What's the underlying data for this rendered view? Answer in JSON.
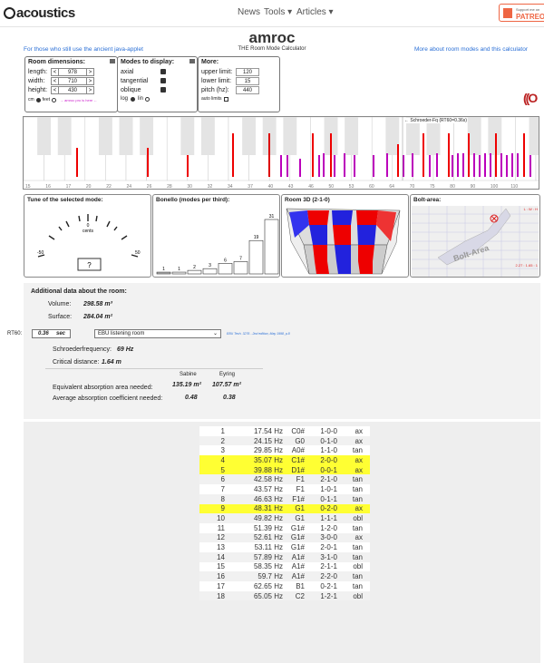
{
  "header": {
    "logo": "acoustics",
    "nav": [
      "News",
      "Tools ▾",
      "Articles ▾"
    ],
    "patreon_small": "Support me on",
    "patreon": "PATREON"
  },
  "page": {
    "title": "amroc",
    "subtitle": "THE Room Mode Calculator",
    "left_link": "For those who still use the ancient java-applet",
    "right_link": "More about room modes and this calculator"
  },
  "dims": {
    "title": "Room dimensions:",
    "length_label": "length:",
    "width_label": "width:",
    "height_label": "height:",
    "length": "978",
    "width": "710",
    "height": "430",
    "unit_cm": "cm",
    "unit_feet": "feet",
    "amroc_link": "→ amroc pro is here ←",
    "dec": "<",
    "inc": ">"
  },
  "modes": {
    "title": "Modes to display:",
    "axial": "axial",
    "tangential": "tangential",
    "oblique": "oblique",
    "log": "log",
    "lin": "lin"
  },
  "more": {
    "title": "More:",
    "upper_label": "upper limit:",
    "lower_label": "lower limit:",
    "pitch_label": "pitch (hz):",
    "upper": "120",
    "lower": "15",
    "pitch": "440",
    "auto": "auto limits"
  },
  "play_symbol": "((O",
  "schroeder_note": "← Schroeder-Fq (RT60=0.36s)",
  "keyboard_ticks": [
    "15",
    "16",
    "17",
    "20",
    "22",
    "24",
    "26",
    "28",
    "30",
    "32",
    "34",
    "37",
    "40",
    "43",
    "46",
    "50",
    "53",
    "60",
    "64",
    "70",
    "75",
    "80",
    "90",
    "100",
    "110"
  ],
  "tune": {
    "title": "Tune of the selected mode:",
    "zero": "0",
    "cents": "cents",
    "minus": "-50",
    "plus": "50",
    "value": "?"
  },
  "bonello": {
    "title": "Bonello (modes per third):",
    "bars": [
      1,
      1,
      2,
      3,
      6,
      7,
      19,
      31
    ],
    "bar_colors": [
      "#bbb",
      "#fff",
      "#fff",
      "#fff",
      "#fff",
      "#fff",
      "#fff",
      "#fff"
    ]
  },
  "room3d": {
    "title": "Room 3D (2-1-0)"
  },
  "bolt": {
    "title": "Bolt-area:",
    "axis": "L : W : H",
    "ratio": "2.27 : 1.65 : 1",
    "watermark": "Bolt-Area"
  },
  "additional": {
    "title": "Additional data about the room:",
    "volume_label": "Volume:",
    "volume": "298.58 m³",
    "surface_label": "Surface:",
    "surface": "284.04 m²",
    "rt60_label": "RT60:",
    "rt60": "0.36",
    "sec": "sec",
    "room_type": "EBU listening room",
    "ebu_ref": "EBU Tech. 3276 - 2nd edition, May 1998, p.8",
    "schroeder_label": "Schroederfrequency:",
    "schroeder": "69 Hz",
    "critical_label": "Critical distance:",
    "critical": "1.64 m",
    "sabine": "Sabine",
    "eyring": "Eyring",
    "eq_label": "Equivalent absorption area needed:",
    "eq_sabine": "135.19 m²",
    "eq_eyring": "107.57 m²",
    "avg_label": "Average absorption coefficient needed:",
    "avg_sabine": "0.48",
    "avg_eyring": "0.38"
  },
  "modes_table": [
    [
      "1",
      "17.54 Hz",
      "C0#",
      "1-0-0",
      "ax"
    ],
    [
      "2",
      "24.15 Hz",
      "G0",
      "0-1-0",
      "ax"
    ],
    [
      "3",
      "29.85 Hz",
      "A0#",
      "1-1-0",
      "tan"
    ],
    [
      "4",
      "35.07 Hz",
      "C1#",
      "2-0-0",
      "ax"
    ],
    [
      "5",
      "39.88 Hz",
      "D1#",
      "0-0-1",
      "ax"
    ],
    [
      "6",
      "42.58 Hz",
      "F1",
      "2-1-0",
      "tan"
    ],
    [
      "7",
      "43.57 Hz",
      "F1",
      "1-0-1",
      "tan"
    ],
    [
      "8",
      "46.63 Hz",
      "F1#",
      "0-1-1",
      "tan"
    ],
    [
      "9",
      "48.31 Hz",
      "G1",
      "0-2-0",
      "ax"
    ],
    [
      "10",
      "49.82 Hz",
      "G1",
      "1-1-1",
      "obl"
    ],
    [
      "11",
      "51.39 Hz",
      "G1#",
      "1-2-0",
      "tan"
    ],
    [
      "12",
      "52.61 Hz",
      "G1#",
      "3-0-0",
      "ax"
    ],
    [
      "13",
      "53.11 Hz",
      "G1#",
      "2-0-1",
      "tan"
    ],
    [
      "14",
      "57.89 Hz",
      "A1#",
      "3-1-0",
      "tan"
    ],
    [
      "15",
      "58.35 Hz",
      "A1#",
      "2-1-1",
      "obl"
    ],
    [
      "16",
      "59.7 Hz",
      "A1#",
      "2-2-0",
      "tan"
    ],
    [
      "17",
      "62.65 Hz",
      "B1",
      "0-2-1",
      "tan"
    ],
    [
      "18",
      "65.05 Hz",
      "C2",
      "1-2-1",
      "obl"
    ]
  ],
  "highlighted_rows": [
    4,
    5,
    9
  ]
}
